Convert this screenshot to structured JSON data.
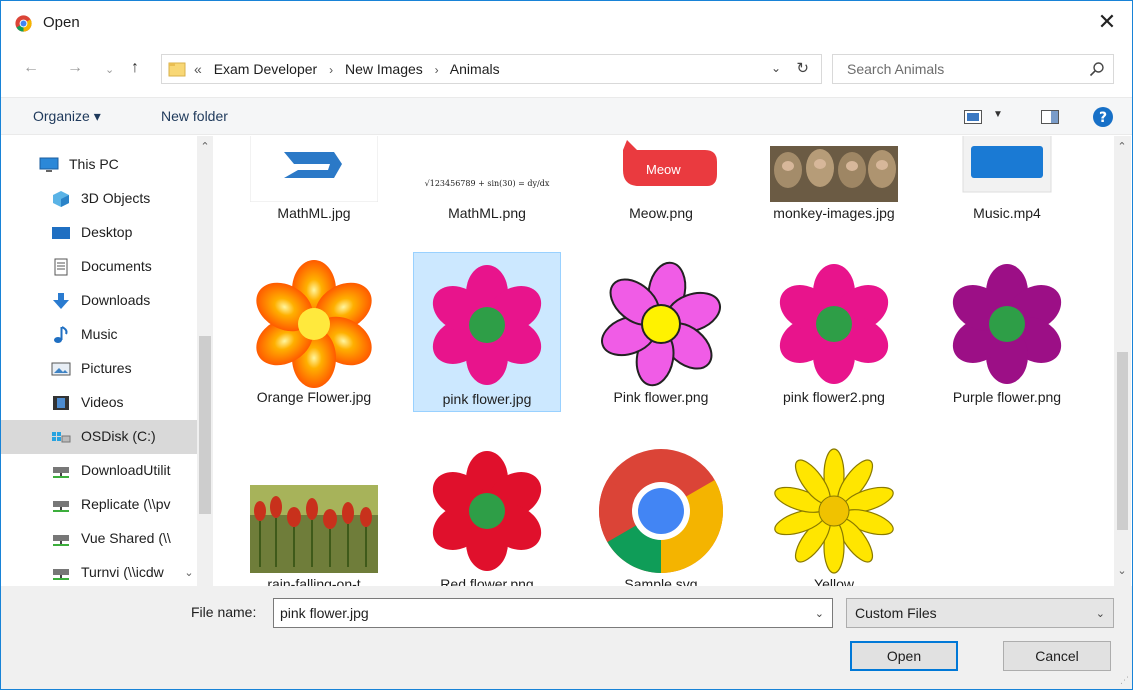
{
  "window": {
    "title": "Open",
    "close_label": "✕"
  },
  "address": {
    "crumb_prefix": "«",
    "crumbs": [
      "Exam Developer",
      "New Images",
      "Animals"
    ]
  },
  "search": {
    "placeholder": "Search Animals"
  },
  "toolbar": {
    "organize": "Organize ▾",
    "new_folder": "New folder"
  },
  "sidebar": {
    "items": [
      {
        "label": "This PC",
        "icon": "monitor-icon"
      },
      {
        "label": "3D Objects",
        "icon": "cube-icon"
      },
      {
        "label": "Desktop",
        "icon": "desktop-icon"
      },
      {
        "label": "Documents",
        "icon": "document-icon"
      },
      {
        "label": "Downloads",
        "icon": "download-arrow-icon"
      },
      {
        "label": "Music",
        "icon": "music-note-icon"
      },
      {
        "label": "Pictures",
        "icon": "picture-icon"
      },
      {
        "label": "Videos",
        "icon": "film-icon"
      },
      {
        "label": "OSDisk (C:)",
        "icon": "drive-icon",
        "selected": true
      },
      {
        "label": "DownloadUtilit",
        "icon": "network-drive-icon"
      },
      {
        "label": "Replicate (\\\\pv",
        "icon": "network-drive-icon"
      },
      {
        "label": "Vue Shared (\\\\",
        "icon": "network-drive-icon"
      },
      {
        "label": "Turnvi (\\\\icdw",
        "icon": "network-drive-icon"
      }
    ]
  },
  "files": [
    {
      "name": "MathML.jpg"
    },
    {
      "name": "MathML.png",
      "thumb_text": "√123456789 + sin(30) = dy/dx"
    },
    {
      "name": "Meow.png",
      "thumb_text": "Meow"
    },
    {
      "name": "monkey-images.jpg"
    },
    {
      "name": "Music.mp4"
    },
    {
      "name": "Orange Flower.jpg"
    },
    {
      "name": "pink flower.jpg",
      "selected": true
    },
    {
      "name": "Pink flower.png"
    },
    {
      "name": "pink flower2.png"
    },
    {
      "name": "Purple flower.png"
    },
    {
      "name": "rain-falling-on-t"
    },
    {
      "name": "Red flower.png"
    },
    {
      "name": "Sample.svg"
    },
    {
      "name": "Yellow"
    }
  ],
  "footer": {
    "filename_label": "File name:",
    "filename_value": "pink flower.jpg",
    "filetype_value": "Custom Files",
    "open_label": "Open",
    "cancel_label": "Cancel"
  },
  "colors": {
    "accent": "#0078d7",
    "selection": "#cce8ff",
    "pink": "#e8148c",
    "purple": "#9c0f86",
    "red": "#e0102c",
    "center_green": "#2e9e47"
  }
}
